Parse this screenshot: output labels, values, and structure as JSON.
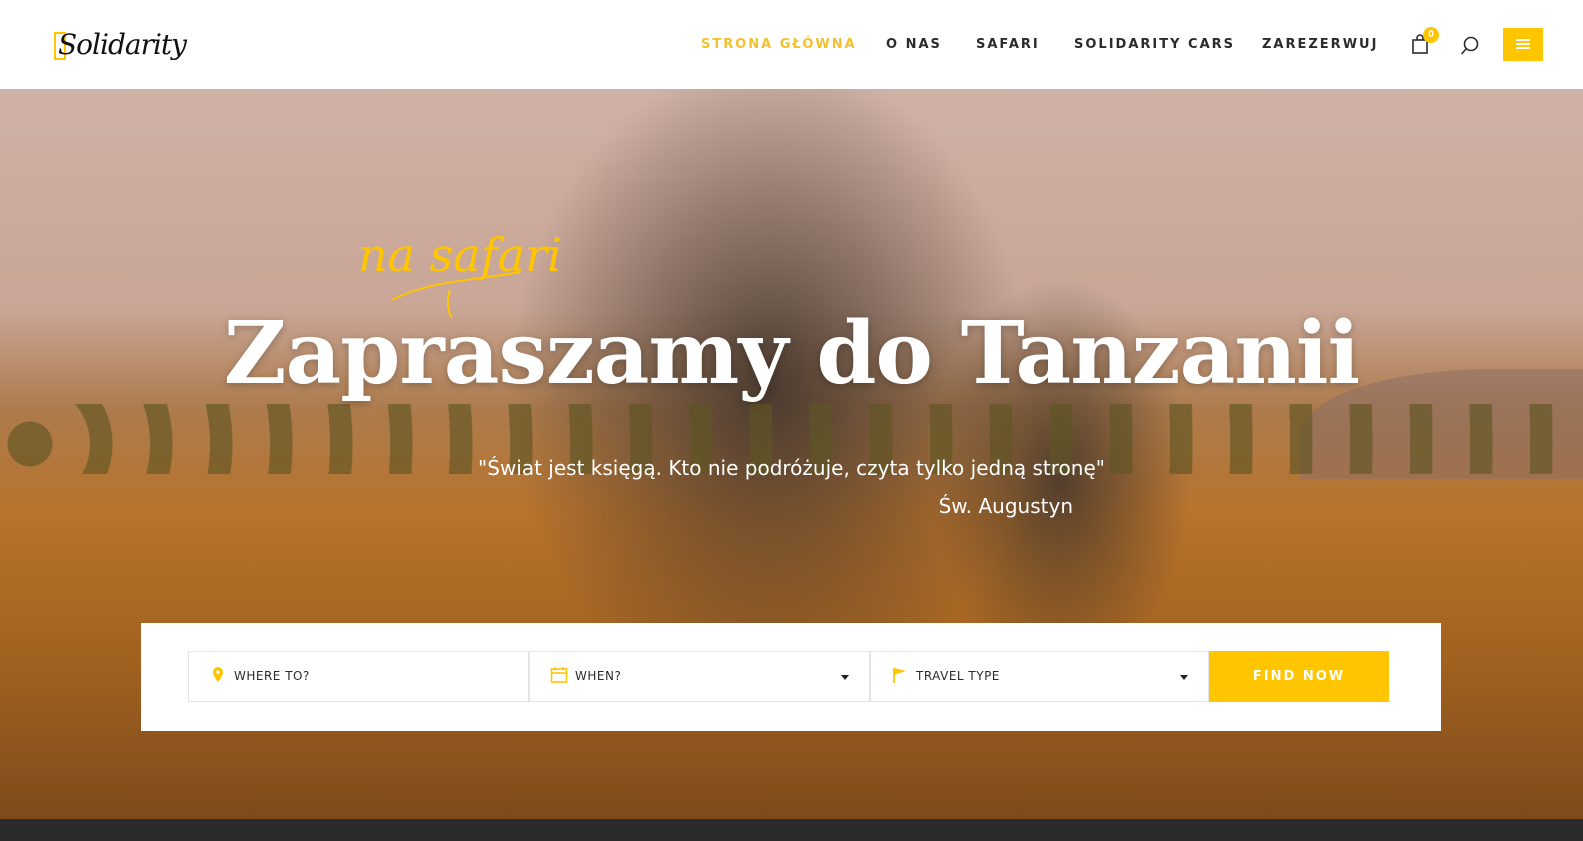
{
  "brand": {
    "logo_text": "Solidarity",
    "accent": "#ffc600"
  },
  "nav": {
    "items": [
      {
        "label": "STRONA GŁÓWNA",
        "active": true
      },
      {
        "label": "O NAS"
      },
      {
        "label": "SAFARI"
      },
      {
        "label": "SOLIDARITY CARS"
      },
      {
        "label": "ZAREZERWUJ"
      }
    ],
    "cart_count": "0",
    "icons": [
      "shopping-bag-icon",
      "search-icon",
      "hamburger-menu-icon"
    ]
  },
  "hero": {
    "script_title": "na safari",
    "headline": "Zapraszamy do Tanzanii",
    "quote": "\"Świat jest księgą. Kto nie podróżuje, czyta tylko jedną stronę\"",
    "author": "Św. Augustyn"
  },
  "search": {
    "where": "WHERE TO?",
    "when": "WHEN?",
    "type": "TRAVEL TYPE",
    "button": "FIND NOW",
    "icons": [
      "map-pin-icon",
      "calendar-icon",
      "flag-icon"
    ]
  }
}
